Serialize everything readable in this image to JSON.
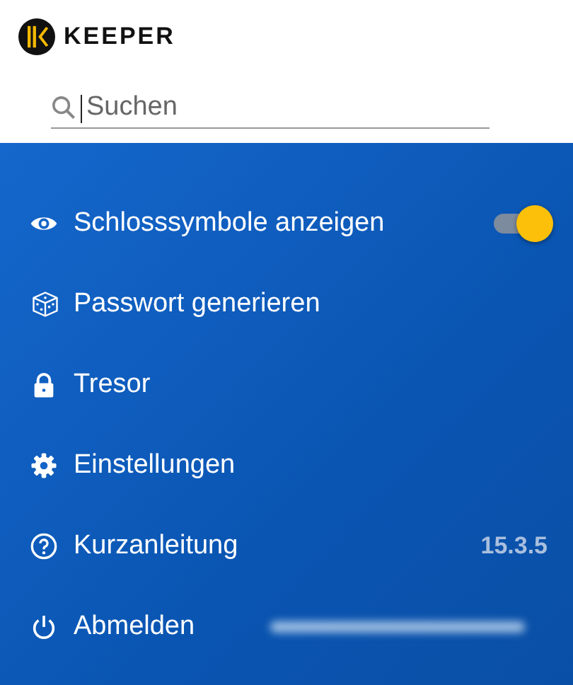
{
  "logo": {
    "text": "KEEPER"
  },
  "search": {
    "placeholder": "Suchen"
  },
  "menu": [
    {
      "kind": "toggle",
      "label": "Schlosssymbole anzeigen",
      "on": true
    },
    {
      "kind": "link",
      "label": "Passwort generieren"
    },
    {
      "kind": "link",
      "label": "Tresor"
    },
    {
      "kind": "link",
      "label": "Einstellungen"
    },
    {
      "kind": "info",
      "label": "Kurzanleitung",
      "detail": "15.3.5"
    },
    {
      "kind": "account",
      "label": "Abmelden"
    }
  ]
}
